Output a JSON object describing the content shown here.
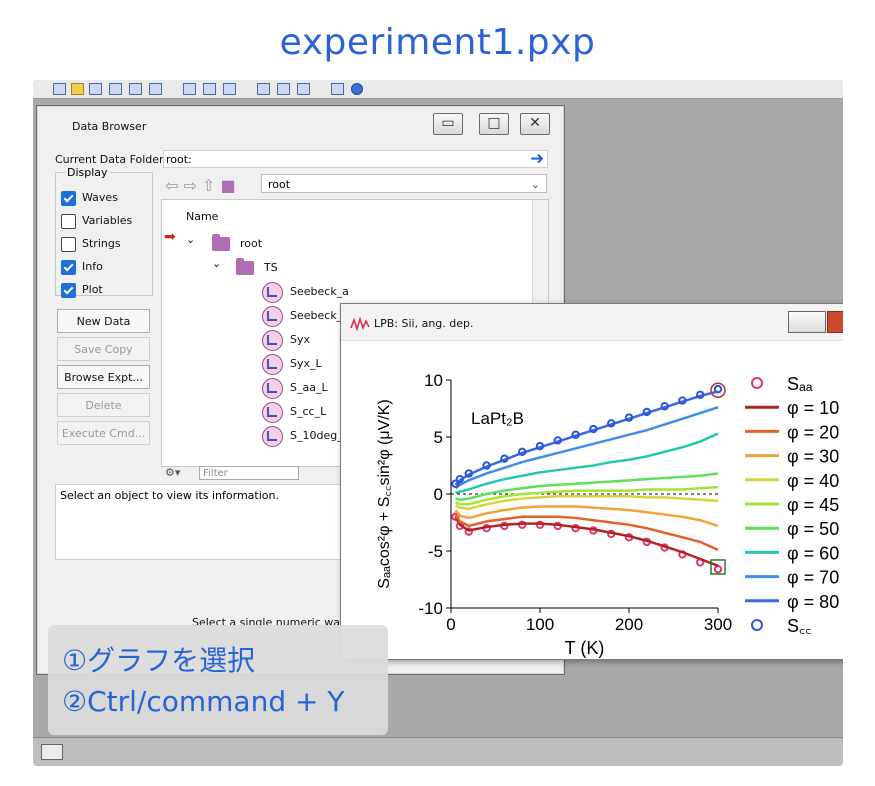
{
  "header": {
    "title": "experiment1.pxp"
  },
  "data_browser": {
    "title": "Data Browser",
    "current_folder_label": "Current Data Folder:",
    "current_folder_value": "root:",
    "display_label": "Display",
    "display_options": [
      {
        "label": "Waves",
        "checked": true
      },
      {
        "label": "Variables",
        "checked": false
      },
      {
        "label": "Strings",
        "checked": false
      },
      {
        "label": "Info",
        "checked": true
      },
      {
        "label": "Plot",
        "checked": true
      }
    ],
    "buttons": [
      {
        "label": "New Data Folder",
        "enabled": true
      },
      {
        "label": "Save Copy",
        "enabled": false
      },
      {
        "label": "Browse Expt...",
        "enabled": true
      },
      {
        "label": "Delete",
        "enabled": false
      },
      {
        "label": "Execute Cmd...",
        "enabled": false
      }
    ],
    "folder_select": "root",
    "tree_header": "Name",
    "tree": {
      "root": "root",
      "subfolder": "TS",
      "waves": [
        "Seebeck_a",
        "Seebeck_",
        "Syx",
        "Syx_L",
        "S_aa_L",
        "S_cc_L",
        "S_10deg_"
      ]
    },
    "filter_placeholder": "Filter",
    "info_text": "Select an object to view its information.",
    "plot_message": "Select a single numeric wave"
  },
  "graph_window": {
    "title": "LPB: Sii, ang. dep.",
    "annotation": "LaPt₂B",
    "y_axis_label": "Sₐₐcos²φ + S꜀꜀sin²φ (μV/K)",
    "x_axis_label": "T (K)",
    "legend": [
      {
        "label": "Sₐₐ",
        "kind": "marker",
        "color": "#e6336f"
      },
      {
        "label": "φ = 10",
        "kind": "line",
        "color": "#b22222"
      },
      {
        "label": "φ = 20",
        "kind": "line",
        "color": "#e4622a"
      },
      {
        "label": "φ = 30",
        "kind": "line",
        "color": "#f2a33a"
      },
      {
        "label": "φ = 40",
        "kind": "line",
        "color": "#d4d63a"
      },
      {
        "label": "φ = 45",
        "kind": "line",
        "color": "#a6e23a"
      },
      {
        "label": "φ = 50",
        "kind": "line",
        "color": "#5fe05a"
      },
      {
        "label": "φ = 60",
        "kind": "line",
        "color": "#22c9b0"
      },
      {
        "label": "φ = 70",
        "kind": "line",
        "color": "#3f8fe8"
      },
      {
        "label": "φ = 80",
        "kind": "line",
        "color": "#3a67e6"
      },
      {
        "label": "S꜀꜀",
        "kind": "marker",
        "color": "#2c55d8"
      }
    ]
  },
  "chart_data": {
    "type": "line",
    "annotation": "LaPt₂B",
    "xlabel": "T (K)",
    "ylabel": "Sₐₐcos²φ + S꜀꜀sin²φ (μV/K)",
    "xlim": [
      0,
      300
    ],
    "ylim": [
      -10,
      10
    ],
    "xticks": [
      0,
      100,
      200,
      300
    ],
    "yticks": [
      -10,
      -5,
      0,
      5,
      10
    ],
    "x": [
      5,
      10,
      20,
      40,
      60,
      80,
      100,
      120,
      140,
      160,
      180,
      200,
      220,
      240,
      260,
      280,
      300
    ],
    "series": [
      {
        "name": "Sₐₐ",
        "marker": "circle",
        "color": "#e6336f",
        "values": [
          -2.0,
          -2.8,
          -3.3,
          -3.0,
          -2.8,
          -2.7,
          -2.7,
          -2.8,
          -3.0,
          -3.2,
          -3.5,
          -3.8,
          -4.2,
          -4.7,
          -5.3,
          -6.0,
          -6.6
        ]
      },
      {
        "name": "φ = 10",
        "color": "#b22222",
        "values": [
          -2.0,
          -2.7,
          -3.2,
          -2.9,
          -2.7,
          -2.6,
          -2.6,
          -2.7,
          -2.9,
          -3.1,
          -3.4,
          -3.7,
          -4.1,
          -4.6,
          -5.1,
          -5.7,
          -6.3
        ]
      },
      {
        "name": "φ = 20",
        "color": "#e4622a",
        "values": [
          -1.8,
          -2.4,
          -2.8,
          -2.4,
          -2.2,
          -2.0,
          -2.0,
          -2.0,
          -2.1,
          -2.3,
          -2.5,
          -2.7,
          -3.0,
          -3.4,
          -3.8,
          -4.2,
          -4.9
        ]
      },
      {
        "name": "φ = 30",
        "color": "#f2a33a",
        "values": [
          -1.4,
          -1.9,
          -2.1,
          -1.7,
          -1.4,
          -1.2,
          -1.1,
          -1.1,
          -1.1,
          -1.2,
          -1.3,
          -1.4,
          -1.6,
          -1.8,
          -2.0,
          -2.3,
          -2.8
        ]
      },
      {
        "name": "φ = 40",
        "color": "#d4d63a",
        "values": [
          -1.0,
          -1.2,
          -1.3,
          -0.9,
          -0.6,
          -0.4,
          -0.3,
          -0.2,
          -0.2,
          -0.2,
          -0.2,
          -0.2,
          -0.3,
          -0.3,
          -0.4,
          -0.5,
          -0.6
        ]
      },
      {
        "name": "φ = 45",
        "color": "#a6e23a",
        "values": [
          -0.7,
          -0.9,
          -0.9,
          -0.5,
          -0.2,
          0.0,
          0.1,
          0.2,
          0.3,
          0.3,
          0.3,
          0.3,
          0.4,
          0.4,
          0.4,
          0.5,
          0.6
        ]
      },
      {
        "name": "φ = 50",
        "color": "#5fe05a",
        "values": [
          -0.4,
          -0.5,
          -0.4,
          0.0,
          0.3,
          0.5,
          0.7,
          0.8,
          0.9,
          1.0,
          1.1,
          1.2,
          1.3,
          1.4,
          1.5,
          1.6,
          1.8
        ]
      },
      {
        "name": "φ = 60",
        "color": "#22c9b0",
        "values": [
          0.1,
          0.2,
          0.4,
          0.9,
          1.3,
          1.6,
          1.9,
          2.1,
          2.3,
          2.5,
          2.8,
          3.0,
          3.3,
          3.7,
          4.1,
          4.6,
          5.3
        ]
      },
      {
        "name": "φ = 70",
        "color": "#3f8fe8",
        "values": [
          0.5,
          0.8,
          1.2,
          1.8,
          2.3,
          2.8,
          3.2,
          3.6,
          4.0,
          4.4,
          4.8,
          5.2,
          5.6,
          6.1,
          6.6,
          7.1,
          7.6
        ]
      },
      {
        "name": "φ = 80",
        "color": "#3a67e6",
        "values": [
          0.8,
          1.2,
          1.7,
          2.4,
          3.0,
          3.6,
          4.1,
          4.6,
          5.1,
          5.6,
          6.1,
          6.6,
          7.1,
          7.6,
          8.1,
          8.6,
          9.0
        ]
      },
      {
        "name": "S꜀꜀",
        "marker": "circle",
        "color": "#2c55d8",
        "values": [
          0.9,
          1.3,
          1.8,
          2.5,
          3.1,
          3.7,
          4.2,
          4.7,
          5.2,
          5.7,
          6.2,
          6.7,
          7.2,
          7.7,
          8.2,
          8.7,
          9.2
        ]
      }
    ],
    "zero_line": true
  },
  "instructions": {
    "step1": "①グラフを選択",
    "step2": "②Ctrl/command + Y"
  }
}
